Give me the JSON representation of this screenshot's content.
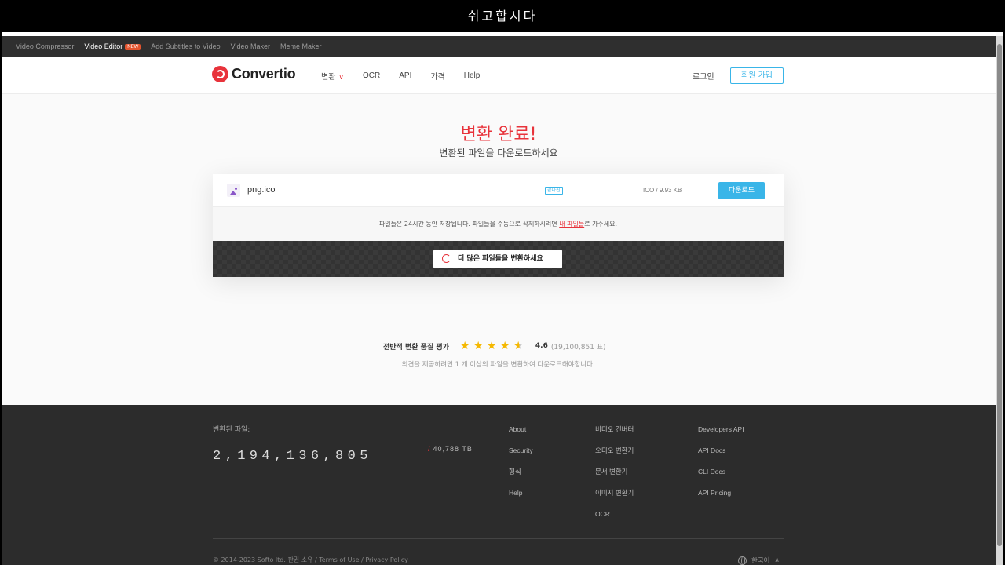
{
  "caption": "쉬고합시다",
  "promo_bar": {
    "items": [
      "Video Compressor",
      "Video Editor",
      "Add Subtitles to Video",
      "Video Maker",
      "Meme Maker"
    ],
    "new_badge": "NEW"
  },
  "header": {
    "logo": "Convertio",
    "nav": [
      "변환",
      "OCR",
      "API",
      "가격",
      "Help"
    ],
    "login": "로그인",
    "signup": "회원 가입"
  },
  "hero": {
    "title": "변환 완료!",
    "subtitle": "변환된 파일을 다운로드하세요"
  },
  "file": {
    "name": "png.ico",
    "status_badge": "끝마친",
    "meta": "ICO / 9.93 KB",
    "download_label": "다운로드"
  },
  "notice": {
    "before": "파일들은 24시간 동안 저장됩니다. 파일들을 수동으로 삭제하시려면 ",
    "link": "내 파일들",
    "after": "로 가주세요."
  },
  "convert_more": "더 많은 파일들을 변환하세요",
  "rating": {
    "title": "전반적 변환 품질 평가",
    "stars": 4.6,
    "score": "4.6",
    "votes": "(19,100,851 표)",
    "note": "의견을 제공하려면 1 개 이상의 파일을 변환하여 다운로드해야합니다!"
  },
  "footer": {
    "converted_label": "변환된 파일:",
    "counter": "2,194,136,805",
    "tb": "40,788 TB",
    "col1": [
      "About",
      "Security",
      "형식",
      "Help"
    ],
    "col2": [
      "비디오 컨버터",
      "오디오 변환기",
      "문서 변환기",
      "이미지 변환기",
      "OCR"
    ],
    "col3": [
      "Developers API",
      "API Docs",
      "CLI Docs",
      "API Pricing"
    ],
    "copyright": "© 2014-2023 Softo ltd. 판권 소유",
    "links": [
      "Terms of Use",
      "Privacy Policy"
    ],
    "language": "한국어"
  },
  "colors": {
    "accent_red": "#e8333b",
    "accent_blue": "#39b5e8",
    "star": "#f5b800",
    "footer_bg": "#2c2c2c"
  }
}
